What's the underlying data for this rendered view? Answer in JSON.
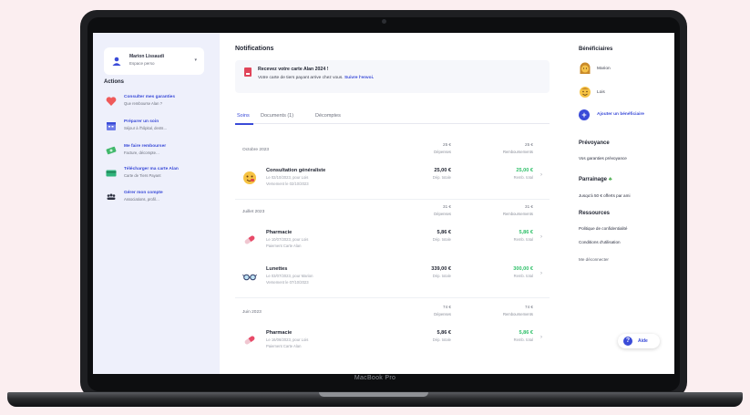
{
  "laptop": {
    "label": "MacBook Pro"
  },
  "sidebar": {
    "user": {
      "name": "Marion Lissaudi",
      "space": "Espace perso",
      "chevron": "▾"
    },
    "actions_title": "Actions",
    "actions": [
      {
        "title": "Consulter mes garanties",
        "subtitle": "Que rembourse Alan ?",
        "icon": "heart-icon"
      },
      {
        "title": "Préparer un soin",
        "subtitle": "Séjour à l'hôpital, dents…",
        "icon": "calendar-icon"
      },
      {
        "title": "Me faire rembourser",
        "subtitle": "Facture, décompte…",
        "icon": "money-icon"
      },
      {
        "title": "Télécharger ma carte Alan",
        "subtitle": "Carte de Tiers Payant",
        "icon": "card-icon"
      },
      {
        "title": "Gérer mon compte",
        "subtitle": "Associations, profil…",
        "icon": "people-icon"
      }
    ]
  },
  "main": {
    "notifications_title": "Notifications",
    "banner": {
      "title": "Recevez votre carte Alan 2024 !",
      "text": "Votre carte de tiers payant arrive chez vous.",
      "link": "Suivre l'envoi."
    },
    "tabs": [
      "Soins",
      "Documents (1)",
      "Décomptes"
    ],
    "months": [
      {
        "label": "Octobre 2023",
        "spent": "25 €",
        "spent_label": "Dépenses",
        "refund": "25 €",
        "refund_label": "Remboursements",
        "rows": [
          {
            "title": "Consultation généraliste",
            "sub1": "Le 02/10/2023, pour Lois",
            "sub2": "Versement le 02/10/2023",
            "amount": "25,00 €",
            "amount_label": "Dép. totale",
            "refund": "25,00 €",
            "refund_label": "Remb. total",
            "icon": "face-icon"
          }
        ]
      },
      {
        "label": "Juillet 2023",
        "spent": "31 €",
        "spent_label": "Dépenses",
        "refund": "31 €",
        "refund_label": "Remboursements",
        "rows": [
          {
            "title": "Pharmacie",
            "sub1": "Le 10/07/2023, pour Lois",
            "sub2": "Paiement Carte Alan",
            "amount": "5,86 €",
            "amount_label": "Dép. totale",
            "refund": "5,86 €",
            "refund_label": "Remb. total",
            "icon": "pill-icon"
          },
          {
            "title": "Lunettes",
            "sub1": "Le 03/07/2023, pour Marion",
            "sub2": "Versement le 07/10/2023",
            "amount": "339,00 €",
            "amount_label": "Dép. totale",
            "refund": "300,00 €",
            "refund_label": "Remb. total",
            "icon": "glasses-icon"
          }
        ]
      },
      {
        "label": "Juin 2023",
        "spent": "74 €",
        "spent_label": "Dépenses",
        "refund": "74 €",
        "refund_label": "Remboursements",
        "rows": [
          {
            "title": "Pharmacie",
            "sub1": "Le 16/06/2023, pour Lois",
            "sub2": "Paiement Carte Alan",
            "amount": "5,86 €",
            "amount_label": "Dép. totale",
            "refund": "5,86 €",
            "refund_label": "Remb. total",
            "icon": "pill-icon"
          }
        ]
      }
    ]
  },
  "right": {
    "beneficiaries_title": "Bénéficiaires",
    "beneficiaries": [
      {
        "name": "Marion",
        "icon": "woman-face-icon"
      },
      {
        "name": "Lois",
        "icon": "smile-face-icon"
      }
    ],
    "add_beneficiary": "Ajouter un bénéficiaire",
    "prevoyance_title": "Prévoyance",
    "prevoyance_link": "Vos garanties prévoyance",
    "parrainage_title": "Parrainage",
    "parrainage_text": "Jusqu'à 50 € offerts par ami",
    "ressources_title": "Ressources",
    "ressources": [
      "Politique de confidentialité",
      "Conditions d'utilisation"
    ],
    "logout": "Me déconnecter",
    "help": "Aide"
  },
  "colors": {
    "accent": "#3a4bd8",
    "refund": "#30c06a",
    "sidebar_bg": "#eef0fb",
    "banner_bg": "#f6f7fb"
  }
}
